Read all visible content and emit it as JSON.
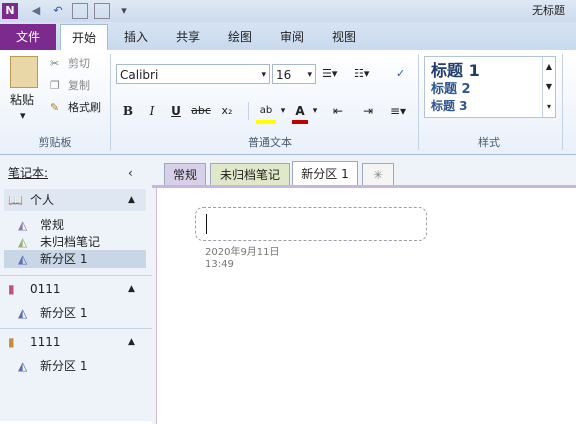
{
  "titlebar": {
    "title": "无标题"
  },
  "ribbon_tabs": [
    "文件",
    "开始",
    "插入",
    "共享",
    "绘图",
    "审阅",
    "视图"
  ],
  "clipboard": {
    "paste": "粘贴",
    "cut": "剪切",
    "copy": "复制",
    "format_painter": "格式刷",
    "group": "剪贴板"
  },
  "text": {
    "font": "Calibri",
    "size": "16",
    "group": "普通文本",
    "bold": "B",
    "italic": "I",
    "underline": "U",
    "strike": "abc",
    "subscript": "x₂",
    "highlight": "ab",
    "fontcolor": "A"
  },
  "styles": {
    "h1": "标题 1",
    "h2": "标题 2",
    "h3": "标题 3",
    "group": "样式"
  },
  "nav": {
    "header": "笔记本:",
    "notebooks": [
      {
        "name": "个人",
        "sections": [
          "常规",
          "未归档笔记",
          "新分区 1"
        ]
      },
      {
        "name": "0111",
        "sections": [
          "新分区 1"
        ]
      },
      {
        "name": "1111",
        "sections": [
          "新分区 1"
        ]
      }
    ]
  },
  "section_tabs": [
    "常规",
    "未归档笔记",
    "新分区 1"
  ],
  "page": {
    "date": "2020年9月11日",
    "time": "13:49"
  },
  "colors": {
    "file_tab": "#7d2a8e",
    "ribbon_bg": "#e9f0fa",
    "notebook_purple": "#c8b6dc"
  }
}
